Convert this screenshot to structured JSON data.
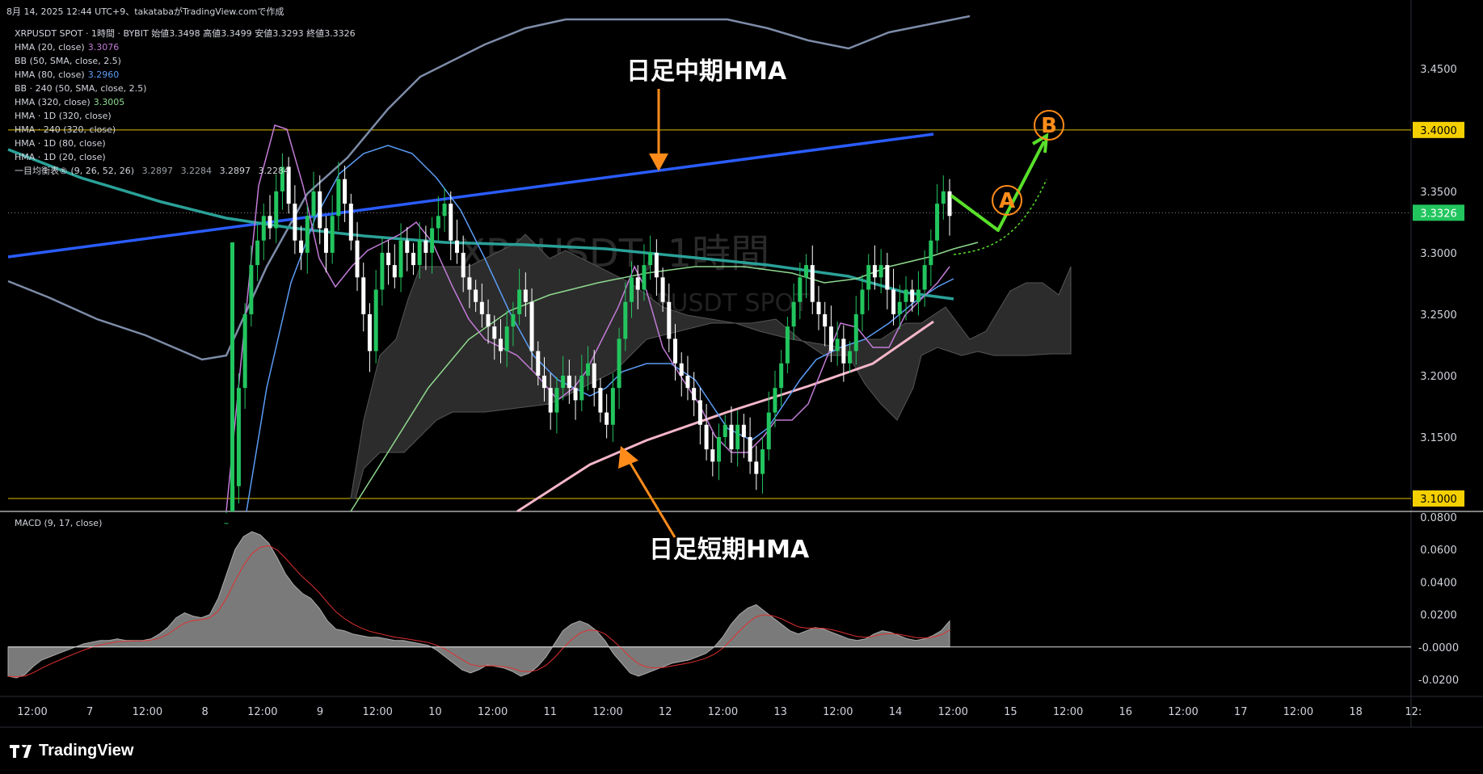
{
  "header": {
    "timestamp": "8月 14, 2025 12:44 UTC+9、takatabaがTradingView.comで作成"
  },
  "symbol_line": {
    "name": "XRPUSDT SPOT · 1時間 · BYBIT",
    "open_label": "始値",
    "open": "3.3498",
    "high_label": "高値",
    "high": "3.3499",
    "low_label": "安値",
    "low": "3.3293",
    "close_label": "終値",
    "close": "3.3326"
  },
  "legend": [
    {
      "label": "HMA (20, close)",
      "value": "3.3076",
      "color": "#c27bd6"
    },
    {
      "label": "BB (50, SMA, close, 2.5)",
      "value": "",
      "color": ""
    },
    {
      "label": "HMA (80, close)",
      "value": "3.2960",
      "color": "#5b9cf5"
    },
    {
      "label": "BB · 240 (50, SMA, close, 2.5)",
      "value": "",
      "color": ""
    },
    {
      "label": "HMA (320, close)",
      "value": "3.3005",
      "color": "#8fd98f"
    },
    {
      "label": "HMA · 1D (320, close)",
      "value": "",
      "color": ""
    },
    {
      "label": "HMA · 240 (320, close)",
      "value": "",
      "color": ""
    },
    {
      "label": "HMA · 1D (80, close)",
      "value": "",
      "color": ""
    },
    {
      "label": "HMA · 1D (20, close)",
      "value": "",
      "color": ""
    }
  ],
  "ichimoku": {
    "label": "一目均衡表® (9, 26, 52, 26)",
    "values": [
      "3.2897",
      "3.2284",
      "3.2897",
      "3.2284"
    ]
  },
  "watermark": {
    "main": "XRPUSDT, 1時間",
    "sub": "XRPUSDT SPOT"
  },
  "annotations": {
    "mid_hma": "日足中期HMA",
    "short_hma": "日足短期HMA",
    "point_a": "A",
    "point_b": "B"
  },
  "macd": {
    "title": "MACD (9, 17, close)"
  },
  "branding": {
    "name": "TradingView"
  },
  "colors": {
    "up": "#22c55e",
    "down": "#ffffff",
    "hma20": "#c27bd6",
    "hma80": "#5b9cf5",
    "hma320": "#8fd98f",
    "daily_mid": "#2a5cff",
    "daily_short": "#f4b6c8",
    "h4_hma": "#2aa198",
    "bb": "#7d8ca8",
    "annotation": "#ff8c1a",
    "projection": "#58e02a"
  },
  "chart_data": {
    "type": "candlestick",
    "y_ticks": [
      "3.4500",
      "3.4000",
      "3.3500",
      "3.3000",
      "3.2500",
      "3.2000",
      "3.1500",
      "3.1000"
    ],
    "y_range": [
      3.1,
      3.49
    ],
    "macd_ticks": [
      "0.0800",
      "0.0600",
      "0.0400",
      "0.0200",
      "-0.0000",
      "-0.0200"
    ],
    "macd_range": [
      -0.03,
      0.08
    ],
    "x_ticks": [
      "12:00",
      "7",
      "12:00",
      "8",
      "12:00",
      "9",
      "12:00",
      "10",
      "12:00",
      "11",
      "12:00",
      "12",
      "12:00",
      "13",
      "12:00",
      "14",
      "12:00",
      "15",
      "12:00",
      "16",
      "12:00",
      "17",
      "12:00",
      "18",
      "12:"
    ],
    "highlight_levels": [
      "3.4000",
      "3.1000"
    ],
    "last_price": "3.3326",
    "candles_close": [
      3.08,
      3.11,
      3.19,
      3.25,
      3.29,
      3.31,
      3.33,
      3.32,
      3.35,
      3.37,
      3.34,
      3.31,
      3.3,
      3.33,
      3.35,
      3.32,
      3.3,
      3.33,
      3.36,
      3.34,
      3.31,
      3.28,
      3.25,
      3.22,
      3.27,
      3.3,
      3.29,
      3.28,
      3.31,
      3.3,
      3.29,
      3.31,
      3.3,
      3.32,
      3.33,
      3.34,
      3.31,
      3.3,
      3.28,
      3.27,
      3.26,
      3.25,
      3.24,
      3.23,
      3.22,
      3.24,
      3.25,
      3.27,
      3.26,
      3.22,
      3.2,
      3.19,
      3.17,
      3.19,
      3.2,
      3.19,
      3.18,
      3.2,
      3.21,
      3.19,
      3.17,
      3.16,
      3.19,
      3.23,
      3.26,
      3.28,
      3.27,
      3.29,
      3.3,
      3.28,
      3.26,
      3.23,
      3.21,
      3.2,
      3.19,
      3.18,
      3.16,
      3.14,
      3.13,
      3.15,
      3.16,
      3.14,
      3.16,
      3.15,
      3.13,
      3.12,
      3.14,
      3.17,
      3.19,
      3.21,
      3.24,
      3.26,
      3.28,
      3.29,
      3.26,
      3.25,
      3.24,
      3.22,
      3.23,
      3.21,
      3.22,
      3.25,
      3.27,
      3.29,
      3.28,
      3.29,
      3.27,
      3.25,
      3.26,
      3.27,
      3.26,
      3.27,
      3.29,
      3.31,
      3.34,
      3.35,
      3.33
    ],
    "series": [
      {
        "name": "HMA (20, close)",
        "values": []
      },
      {
        "name": "HMA (80, close)",
        "values": []
      },
      {
        "name": "HMA (320, close)",
        "values": []
      }
    ],
    "macd_values": [
      -0.018,
      -0.019,
      -0.017,
      -0.012,
      -0.008,
      -0.006,
      -0.004,
      -0.002,
      0.0,
      0.002,
      0.003,
      0.004,
      0.004,
      0.005,
      0.004,
      0.004,
      0.004,
      0.005,
      0.008,
      0.012,
      0.018,
      0.021,
      0.019,
      0.018,
      0.02,
      0.03,
      0.045,
      0.06,
      0.068,
      0.071,
      0.069,
      0.064,
      0.055,
      0.045,
      0.038,
      0.033,
      0.03,
      0.024,
      0.016,
      0.011,
      0.01,
      0.008,
      0.007,
      0.006,
      0.006,
      0.005,
      0.004,
      0.004,
      0.003,
      0.002,
      0.001,
      -0.002,
      -0.006,
      -0.01,
      -0.014,
      -0.016,
      -0.014,
      -0.011,
      -0.012,
      -0.013,
      -0.015,
      -0.018,
      -0.016,
      -0.012,
      -0.006,
      0.002,
      0.01,
      0.014,
      0.016,
      0.014,
      0.01,
      0.004,
      -0.004,
      -0.01,
      -0.016,
      -0.018,
      -0.016,
      -0.014,
      -0.012,
      -0.01,
      -0.009,
      -0.008,
      -0.006,
      -0.004,
      0.0,
      0.006,
      0.014,
      0.02,
      0.024,
      0.026,
      0.022,
      0.018,
      0.014,
      0.01,
      0.008,
      0.01,
      0.012,
      0.011,
      0.009,
      0.007,
      0.005,
      0.004,
      0.005,
      0.008,
      0.01,
      0.009,
      0.007,
      0.005,
      0.004,
      0.005,
      0.007,
      0.01,
      0.016
    ]
  }
}
